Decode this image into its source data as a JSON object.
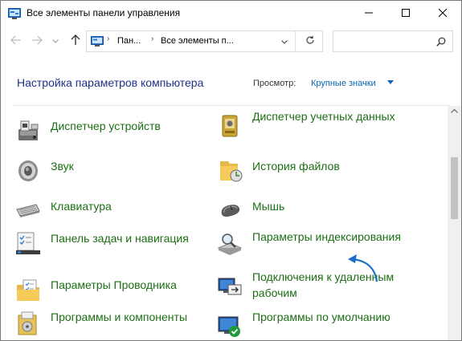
{
  "window": {
    "title": "Все элементы панели управления"
  },
  "titlebar": {
    "min_icon": "minimize-icon",
    "max_icon": "maximize-icon",
    "close_icon": "close-icon"
  },
  "nav": {
    "address_segments": [
      "Пан...",
      "Все элементы п..."
    ],
    "search_placeholder": ""
  },
  "header": {
    "title": "Настройка параметров компьютера",
    "view_label": "Просмотр:",
    "view_value": "Крупные значки"
  },
  "items": [
    {
      "label": "Диспетчер устройств",
      "icon": "device-manager-icon"
    },
    {
      "label": "Диспетчер учетных данных",
      "icon": "credential-manager-icon"
    },
    {
      "label": "Звук",
      "icon": "speaker-icon"
    },
    {
      "label": "История файлов",
      "icon": "file-history-icon"
    },
    {
      "label": "Клавиатура",
      "icon": "keyboard-icon"
    },
    {
      "label": "Мышь",
      "icon": "mouse-icon"
    },
    {
      "label": "Панель задач и навигация",
      "icon": "taskbar-icon"
    },
    {
      "label": "Параметры индексирования",
      "icon": "indexing-options-icon"
    },
    {
      "label": "Параметры Проводника",
      "icon": "folder-options-icon"
    },
    {
      "label": "Подключения к удаленным рабочим",
      "icon": "remote-desktop-icon"
    },
    {
      "label": "Программы и компоненты",
      "icon": "programs-features-icon"
    },
    {
      "label": "Программы по умолчанию",
      "icon": "default-programs-icon"
    }
  ],
  "colors": {
    "link_green": "#1c6e14",
    "title_blue": "#1e3287",
    "accent_blue": "#0a64b4",
    "annotation_arrow": "#1a6fc4"
  }
}
